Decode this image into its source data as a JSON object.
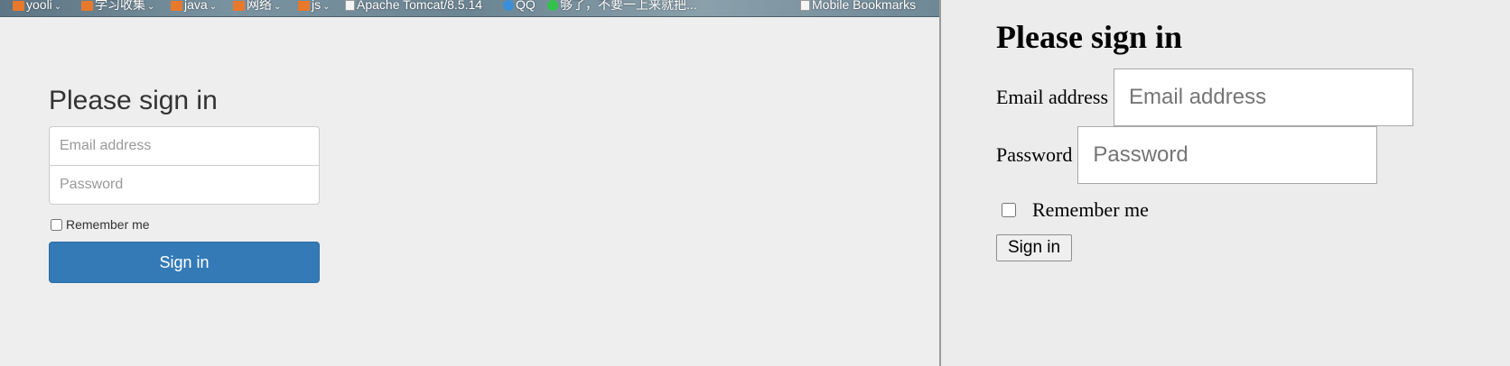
{
  "bookmarks": {
    "items": [
      {
        "label": "yooli",
        "icon": "folder-icon"
      },
      {
        "label": "学习收集",
        "icon": "folder-icon"
      },
      {
        "label": "java",
        "icon": "folder-icon"
      },
      {
        "label": "网络",
        "icon": "folder-icon"
      },
      {
        "label": "js",
        "icon": "folder-icon"
      },
      {
        "label": "Apache Tomcat/8.5.14",
        "icon": "page-icon"
      },
      {
        "label": "QQ",
        "icon": "qq-icon"
      },
      {
        "label": "够了，不要一上来就把...",
        "icon": "green-dot-icon"
      },
      {
        "label": "Mobile Bookmarks",
        "icon": "page-icon"
      }
    ]
  },
  "styled_form": {
    "heading": "Please sign in",
    "email_placeholder": "Email address",
    "password_placeholder": "Password",
    "remember_label": "Remember me",
    "signin_label": "Sign in",
    "accent_color": "#337ab7"
  },
  "plain_form": {
    "heading": "Please sign in",
    "email_label": "Email address",
    "email_placeholder": "Email address",
    "password_label": "Password",
    "password_placeholder": "Password",
    "remember_label": "Remember me",
    "signin_label": "Sign in"
  }
}
